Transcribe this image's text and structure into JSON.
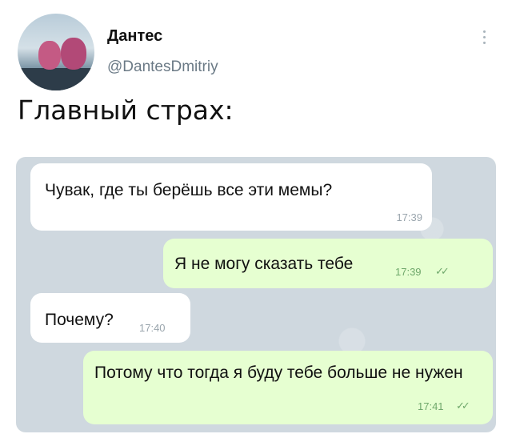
{
  "tweet": {
    "author_name": "Дантес",
    "author_handle": "@DantesDmitriy",
    "text": "Главный страх:"
  },
  "chat": {
    "messages": [
      {
        "direction": "incoming",
        "text": "Чувак, где ты берёшь все эти мемы?",
        "time": "17:39"
      },
      {
        "direction": "outgoing",
        "text": "Я не могу сказать тебе",
        "time": "17:39",
        "read_mark": "✓✓"
      },
      {
        "direction": "incoming",
        "text": "Почему?",
        "time": "17:40"
      },
      {
        "direction": "outgoing",
        "text": "Потому что тогда я буду тебе больше не нужен",
        "time": "17:41",
        "read_mark": "✓✓"
      }
    ]
  },
  "icons": {
    "more": "more-vertical-icon",
    "read_receipt": "double-check-icon"
  },
  "colors": {
    "incoming_bubble": "#ffffff",
    "outgoing_bubble": "#e6ffd1",
    "chat_background": "#cfd8df",
    "handle_text": "#6b7a86"
  }
}
